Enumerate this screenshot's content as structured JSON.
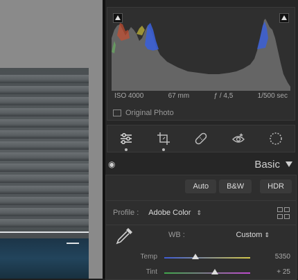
{
  "histogram": {
    "exif": {
      "iso": "ISO 4000",
      "focal": "67 mm",
      "aperture": "ƒ / 4,5",
      "shutter": "1/500 sec"
    },
    "original_photo_label": "Original Photo"
  },
  "tools": [
    {
      "name": "edit-sliders-icon",
      "active": true
    },
    {
      "name": "crop-icon",
      "active": false
    },
    {
      "name": "healing-icon",
      "active": false
    },
    {
      "name": "red-eye-icon",
      "active": false
    },
    {
      "name": "masking-icon",
      "active": false
    }
  ],
  "basic": {
    "title": "Basic",
    "buttons": {
      "auto": "Auto",
      "bw": "B&W",
      "hdr": "HDR"
    },
    "profile_label": "Profile :",
    "profile_value": "Adobe Color",
    "wb_label": "WB :",
    "wb_value": "Custom",
    "sliders": [
      {
        "label": "Temp",
        "value": "5350",
        "position": 0.36,
        "gradient": [
          "#3d5bd6",
          "#d6c94a"
        ]
      },
      {
        "label": "Tint",
        "value": "+ 25",
        "position": 0.59,
        "gradient": [
          "#3fa84a",
          "#c04ad0"
        ]
      }
    ]
  },
  "colors": {
    "panel": "#262626",
    "panel_box": "#2e2e2e",
    "accent_text": "#d0d0d0"
  }
}
